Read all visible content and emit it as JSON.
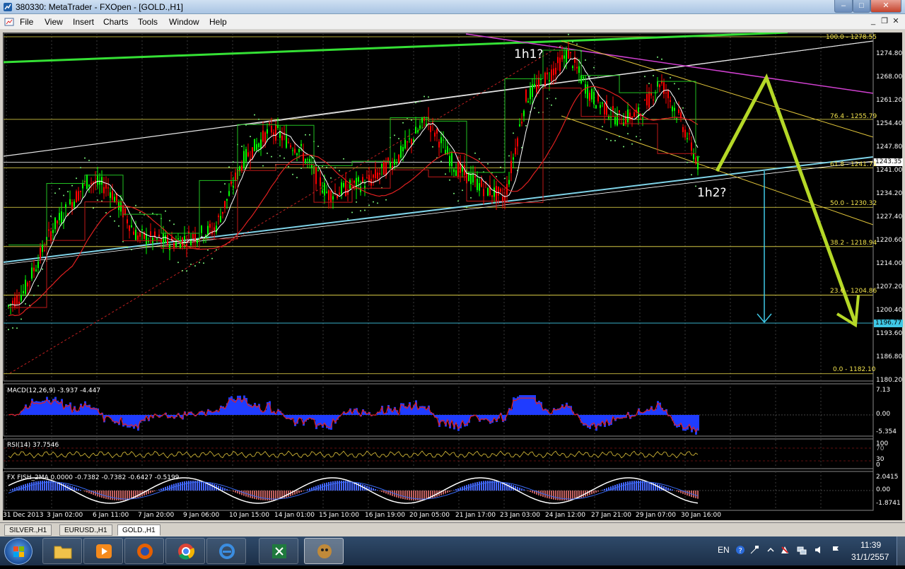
{
  "window": {
    "title": "380330: MetaTrader - FXOpen - [GOLD.,H1]",
    "controls": {
      "minimize": "–",
      "maximize": "□",
      "close": "✕"
    }
  },
  "menu": {
    "items": [
      "File",
      "View",
      "Insert",
      "Charts",
      "Tools",
      "Window",
      "Help"
    ],
    "mdi_controls": {
      "minimize": "_",
      "restore": "❐",
      "close": "✕"
    }
  },
  "chart": {
    "symbol": "GOLD.",
    "timeframe": "H1",
    "price_scale": [
      "1274.80",
      "1268.00",
      "1261.20",
      "1254.40",
      "1247.80",
      "1241.00",
      "1234.20",
      "1227.40",
      "1220.60",
      "1214.00",
      "1207.20",
      "1200.40",
      "1193.60",
      "1186.80",
      "1180.20"
    ],
    "date_scale": [
      "31 Dec 2013",
      "3 Jan 02:00",
      "6 Jan 11:00",
      "7 Jan 20:00",
      "9 Jan 06:00",
      "10 Jan 15:00",
      "14 Jan 01:00",
      "15 Jan 10:00",
      "16 Jan 19:00",
      "20 Jan 05:00",
      "21 Jan 17:00",
      "23 Jan 03:00",
      "24 Jan 12:00",
      "27 Jan 21:00",
      "29 Jan 07:00",
      "30 Jan 16:00"
    ],
    "fibonacci": [
      {
        "label": "100.0 - 1278.55",
        "price": 1278.55
      },
      {
        "label": "76.4 - 1255.79",
        "price": 1255.79
      },
      {
        "label": "61.8 - 1241.71",
        "price": 1241.71
      },
      {
        "label": "50.0 - 1230.32",
        "price": 1230.32
      },
      {
        "label": "38.2 - 1218.94",
        "price": 1218.94
      },
      {
        "label": "23.6 - 1204.86",
        "price": 1204.86
      },
      {
        "label": "0.0 - 1182.10",
        "price": 1182.1
      }
    ],
    "current_price": "1243.35",
    "target_price": "1196.77",
    "annotations": {
      "wave1": "1h1?",
      "wave2": "1h2?"
    },
    "colors": {
      "background": "#000000",
      "bull_candle": "#00ff00",
      "bear_candle": "#ff0000",
      "fibonacci": "#f2e34d",
      "forecast_arrow": "#b5d827",
      "target_arrow": "#3fc8e6",
      "support_line": "#7fd3e8",
      "resistance_line": "#d040d0",
      "channel_green": "#35e035"
    }
  },
  "indicators": {
    "macd": {
      "label": "MACD(12,26,9) -3.937 -4.447",
      "scale": [
        "7.13",
        "0.00",
        "-5.354"
      ]
    },
    "rsi": {
      "label": "RSI(14) 37.7546",
      "scale": [
        "100",
        "70",
        "30",
        "0"
      ]
    },
    "fisher": {
      "label": "FX FISH_2MA 0.0000 -0.7382 -0.7382 -0.6427 -0.5199",
      "scale": [
        "2.0415",
        "0.00",
        "-1.8741"
      ]
    }
  },
  "tabs": [
    {
      "label": "SILVER.,H1",
      "active": false
    },
    {
      "label": "EURUSD.,H1",
      "active": false
    },
    {
      "label": "GOLD.,H1",
      "active": true
    }
  ],
  "taskbar": {
    "apps": [
      "folder-icon",
      "media-player-icon",
      "firefox-icon",
      "chrome-icon",
      "internet-explorer-icon",
      "excel-icon",
      "metatrader-icon"
    ],
    "language": "EN",
    "time": "11:39",
    "date": "31/1/2557"
  }
}
